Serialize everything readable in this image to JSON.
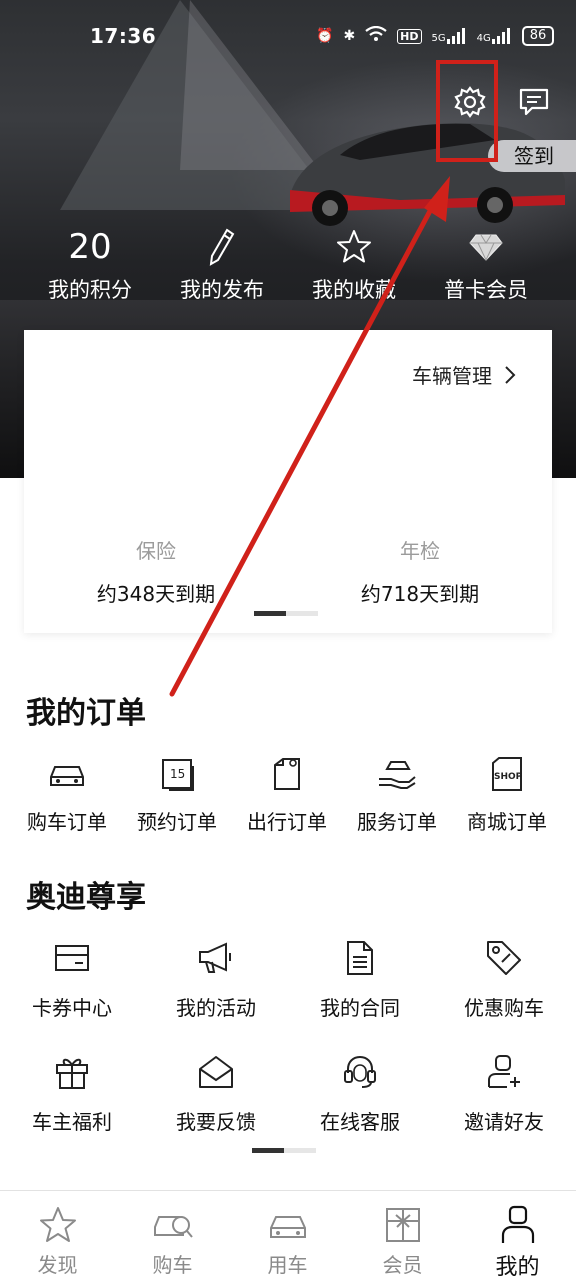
{
  "status_bar": {
    "time": "17:36",
    "battery": "86",
    "hd_label": "HD",
    "net1": "5G",
    "net2": "4G"
  },
  "header": {
    "signin_label": "签到"
  },
  "stats": [
    {
      "value": "20",
      "label": "我的积分"
    },
    {
      "icon": "pencil-icon",
      "label": "我的发布"
    },
    {
      "icon": "star-icon",
      "label": "我的收藏"
    },
    {
      "icon": "diamond-icon",
      "label": "普卡会员"
    }
  ],
  "vehicle_card": {
    "manage_label": "车辆管理",
    "insurance": {
      "title": "保险",
      "value": "约348天到期"
    },
    "inspection": {
      "title": "年检",
      "value": "约718天到期"
    }
  },
  "orders": {
    "title": "我的订单",
    "items": [
      {
        "icon": "car-icon",
        "label": "购车订单"
      },
      {
        "icon": "calendar-icon",
        "label": "预约订单",
        "badge": "15"
      },
      {
        "icon": "document-icon",
        "label": "出行订单"
      },
      {
        "icon": "service-hand-icon",
        "label": "服务订单"
      },
      {
        "icon": "shop-icon",
        "label": "商城订单",
        "badge": "SHOP"
      }
    ]
  },
  "exclusive": {
    "title": "奥迪尊享",
    "items": [
      {
        "icon": "card-icon",
        "label": "卡券中心"
      },
      {
        "icon": "megaphone-icon",
        "label": "我的活动"
      },
      {
        "icon": "contract-icon",
        "label": "我的合同"
      },
      {
        "icon": "tag-icon",
        "label": "优惠购车"
      },
      {
        "icon": "gift-icon",
        "label": "车主福利"
      },
      {
        "icon": "envelope-icon",
        "label": "我要反馈"
      },
      {
        "icon": "headset-icon",
        "label": "在线客服"
      },
      {
        "icon": "add-user-icon",
        "label": "邀请好友"
      }
    ]
  },
  "bottom_nav": [
    {
      "icon": "star-icon",
      "label": "发现"
    },
    {
      "icon": "car-search-icon",
      "label": "购车"
    },
    {
      "icon": "car-icon",
      "label": "用车"
    },
    {
      "icon": "gift-icon",
      "label": "会员"
    },
    {
      "icon": "user-icon",
      "label": "我的",
      "active": true
    }
  ],
  "colors": {
    "annotation_red": "#d0211a",
    "hero_dark": "#1e1f21"
  }
}
